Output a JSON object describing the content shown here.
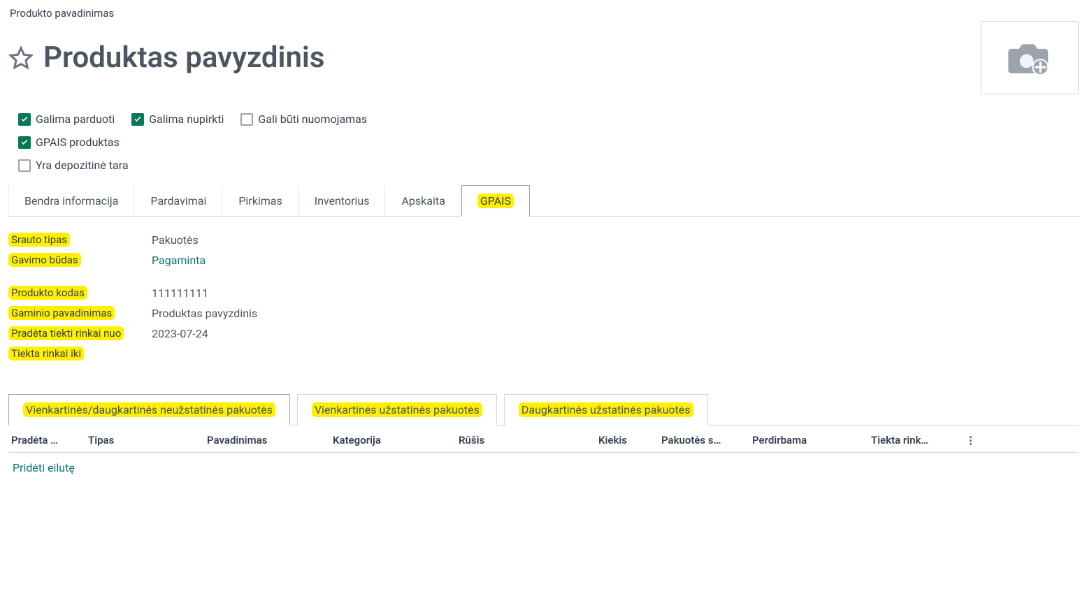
{
  "header": {
    "small_label": "Produkto pavadinimas",
    "title": "Produktas pavyzdinis"
  },
  "checks": {
    "sell": {
      "label": "Galima parduoti",
      "checked": true
    },
    "buy": {
      "label": "Galima nupirkti",
      "checked": true
    },
    "rent": {
      "label": "Gali būti nuomojamas",
      "checked": false
    },
    "gpais": {
      "label": "GPAIS produktas",
      "checked": true
    },
    "deposit": {
      "label": "Yra depozitinė tara",
      "checked": false
    }
  },
  "tabs": {
    "general": "Bendra informacija",
    "sales": "Pardavimai",
    "purchase": "Pirkimas",
    "inventory": "Inventorius",
    "accounting": "Apskaita",
    "gpais": "GPAIS"
  },
  "form": {
    "flow_type_label": "Srauto tipas",
    "flow_type_value": "Pakuotės",
    "acq_label": "Gavimo būdas",
    "acq_value": "Pagaminta",
    "code_label": "Produkto kodas",
    "code_value": "111111111",
    "pname_label": "Gaminio pavadinimas",
    "pname_value": "Produktas pavyzdinis",
    "start_label": "Pradėta tiekti rinkai nuo",
    "start_value": "2023-07-24",
    "end_label": "Tiekta rinkai iki",
    "end_value": ""
  },
  "subtabs": {
    "single_multi": "Vienkartinės/daugkartinės neužstatinės pakuotės",
    "single_deposit": "Vienkartinės užstatinės pakuotės",
    "multi_deposit": "Daugkartinės užstatinės pakuotės"
  },
  "grid": {
    "cols": {
      "started": "Pradėta …",
      "type": "Tipas",
      "name": "Pavadinimas",
      "category": "Kategorija",
      "kind": "Rūšis",
      "qty": "Kiekis",
      "pkg_w": "Pakuotės s…",
      "recyclable": "Perdirbama",
      "until": "Tiekta rink…"
    },
    "add_row": "Pridėti eilutę"
  }
}
